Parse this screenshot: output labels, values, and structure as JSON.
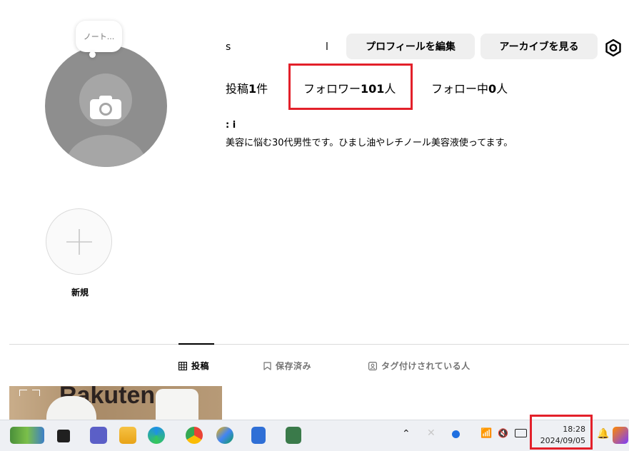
{
  "profile": {
    "note_bubble": "ノート...",
    "username_fragment_1": "s",
    "username_fragment_2": "l",
    "edit_profile_label": "プロフィールを編集",
    "archive_label": "アーカイブを見る"
  },
  "stats": {
    "posts_prefix": "投稿",
    "posts_count": "1",
    "posts_suffix": "件",
    "followers_prefix": "フォロワー",
    "followers_count": "101",
    "followers_suffix": "人",
    "following_prefix": "フォロー中",
    "following_count": "0",
    "following_suffix": "人"
  },
  "bio": {
    "name_fragment": ":   i",
    "text": "美容に悩む30代男性です。ひまし油やレチノール美容液使ってます。"
  },
  "highlights": {
    "new_label": "新規"
  },
  "tabs": [
    {
      "label": "投稿",
      "icon": "grid-icon",
      "active": true
    },
    {
      "label": "保存済み",
      "icon": "bookmark-icon",
      "active": false
    },
    {
      "label": "タグ付けされている人",
      "icon": "tag-person-icon",
      "active": false
    }
  ],
  "post_thumbnail": {
    "text": "Rakuten"
  },
  "taskbar": {
    "time": "18:28",
    "date": "2024/09/05"
  },
  "colors": {
    "highlight_box": "#e3202a",
    "button_bg": "#efefef",
    "avatar_bg": "#8e8e8e"
  }
}
